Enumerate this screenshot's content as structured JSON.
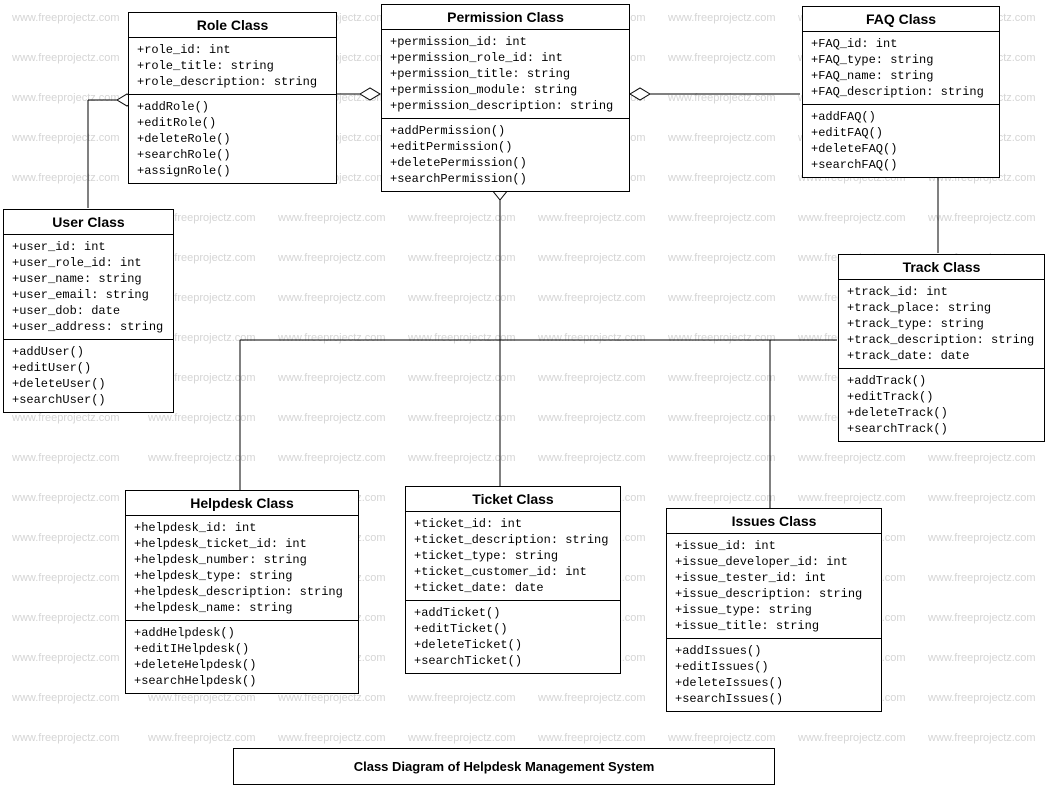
{
  "watermark_text": "www.freeprojectz.com",
  "diagram_title": "Class Diagram of Helpdesk Management System",
  "classes": {
    "role": {
      "title": "Role Class",
      "attrs": [
        "+role_id: int",
        "+role_title: string",
        "+role_description: string"
      ],
      "ops": [
        "+addRole()",
        "+editRole()",
        "+deleteRole()",
        "+searchRole()",
        "+assignRole()"
      ]
    },
    "permission": {
      "title": "Permission Class",
      "attrs": [
        "+permission_id: int",
        "+permission_role_id: int",
        "+permission_title: string",
        "+permission_module: string",
        "+permission_description: string"
      ],
      "ops": [
        "+addPermission()",
        "+editPermission()",
        "+deletePermission()",
        "+searchPermission()"
      ]
    },
    "faq": {
      "title": "FAQ Class",
      "attrs": [
        "+FAQ_id: int",
        "+FAQ_type: string",
        "+FAQ_name: string",
        "+FAQ_description: string"
      ],
      "ops": [
        "+addFAQ()",
        "+editFAQ()",
        "+deleteFAQ()",
        "+searchFAQ()"
      ]
    },
    "user": {
      "title": "User Class",
      "attrs": [
        "+user_id: int",
        "+user_role_id: int",
        "+user_name: string",
        "+user_email: string",
        "+user_dob: date",
        "+user_address: string"
      ],
      "ops": [
        "+addUser()",
        "+editUser()",
        "+deleteUser()",
        "+searchUser()"
      ]
    },
    "track": {
      "title": "Track Class",
      "attrs": [
        "+track_id: int",
        "+track_place: string",
        "+track_type: string",
        "+track_description: string",
        "+track_date: date"
      ],
      "ops": [
        "+addTrack()",
        "+editTrack()",
        "+deleteTrack()",
        "+searchTrack()"
      ]
    },
    "helpdesk": {
      "title": "Helpdesk Class",
      "attrs": [
        "+helpdesk_id: int",
        "+helpdesk_ticket_id: int",
        "+helpdesk_number: string",
        "+helpdesk_type: string",
        "+helpdesk_description: string",
        "+helpdesk_name: string"
      ],
      "ops": [
        "+addHelpdesk()",
        "+editIHelpdesk()",
        "+deleteHelpdesk()",
        "+searchHelpdesk()"
      ]
    },
    "ticket": {
      "title": "Ticket Class",
      "attrs": [
        "+ticket_id: int",
        "+ticket_description: string",
        "+ticket_type: string",
        "+ticket_customer_id: int",
        "+ticket_date: date"
      ],
      "ops": [
        "+addTicket()",
        "+editTicket()",
        "+deleteTicket()",
        "+searchTicket()"
      ]
    },
    "issues": {
      "title": "Issues Class",
      "attrs": [
        "+issue_id: int",
        "+issue_developer_id: int",
        "+issue_tester_id: int",
        "+issue_description: string",
        "+issue_type: string",
        "+issue_title: string"
      ],
      "ops": [
        "+addIssues()",
        "+editIssues()",
        "+deleteIssues()",
        "+searchIssues()"
      ]
    }
  }
}
